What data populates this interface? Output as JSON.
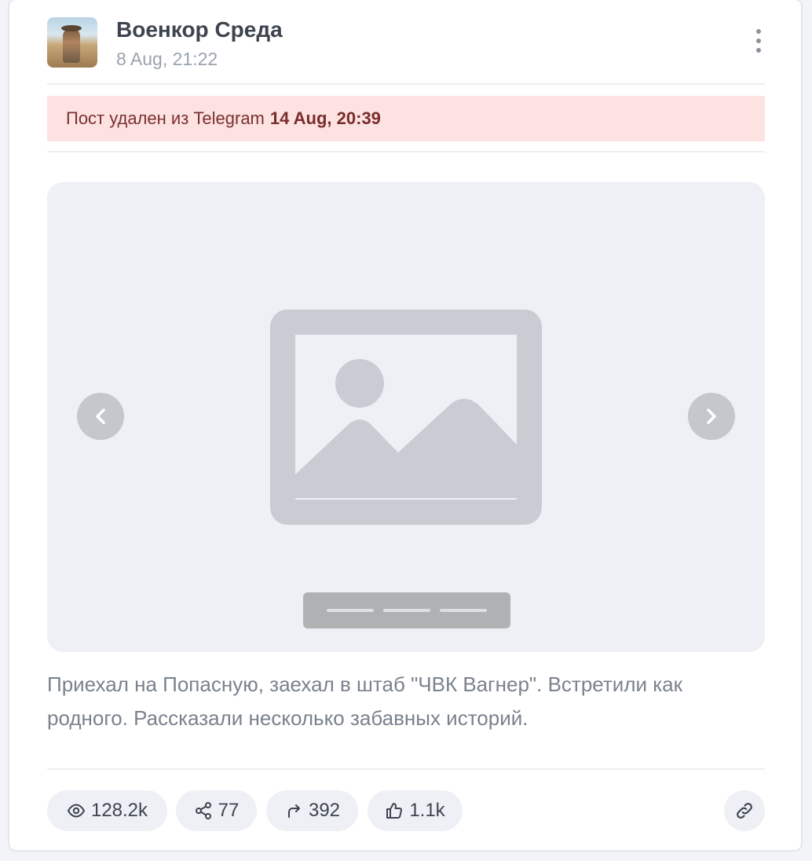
{
  "post": {
    "channel_name": "Военкор Среда",
    "date": "8 Aug, 21:22",
    "deleted_notice": {
      "prefix": "Пост удален из Telegram",
      "timestamp": "14 Aug, 20:39"
    },
    "text": "Приехал на Попасную, заехал в штаб \"ЧВК Вагнер\". Встретили как родного. Рассказали несколько забавных историй.",
    "media": {
      "slide_count": 3,
      "icons": {
        "placeholder": "image-placeholder-icon",
        "prev": "chevron-left-icon",
        "next": "chevron-right-icon"
      }
    },
    "stats": {
      "views": "128.2k",
      "shares": "77",
      "forwards": "392",
      "likes": "1.1k"
    },
    "icons": {
      "menu": "more-vertical-icon",
      "views": "eye-icon",
      "shares": "share-nodes-icon",
      "forwards": "forward-arrow-icon",
      "likes": "thumbs-up-icon",
      "link": "link-icon"
    },
    "colors": {
      "banner_bg": "#fde2e2",
      "banner_text": "#7b3030",
      "media_bg": "#eef0f6",
      "pill_bg": "#eef0f6"
    }
  }
}
